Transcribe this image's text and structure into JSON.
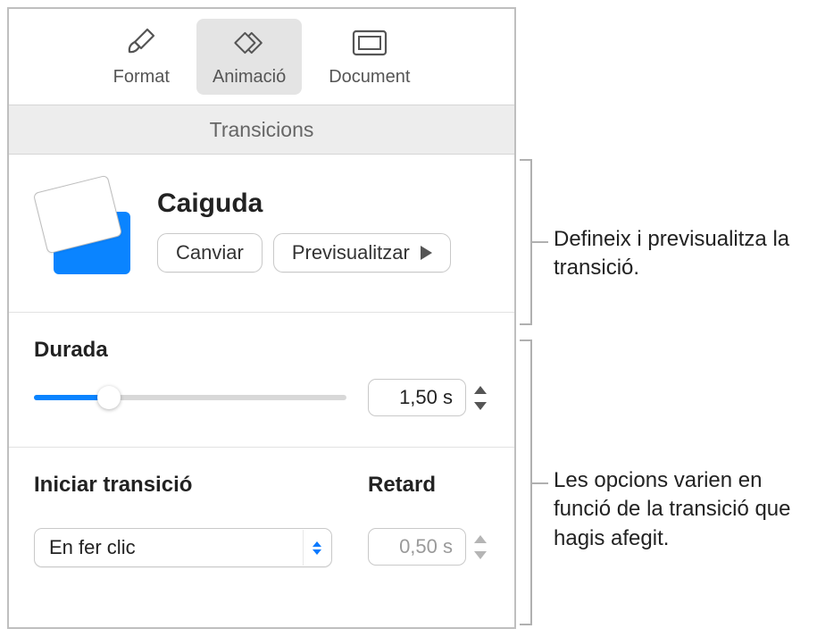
{
  "toolbar": {
    "format_label": "Format",
    "animation_label": "Animació",
    "document_label": "Document",
    "selected": "animation"
  },
  "section": {
    "title": "Transicions"
  },
  "transition": {
    "name": "Caiguda",
    "change_label": "Canviar",
    "preview_label": "Previsualitzar"
  },
  "duration": {
    "label": "Durada",
    "value_display": "1,50 s",
    "value_seconds": 1.5,
    "min": 0.5,
    "max": 5.0,
    "slider_percent": 24
  },
  "start": {
    "label": "Iniciar transició",
    "selected_option": "En fer clic"
  },
  "delay": {
    "label": "Retard",
    "value_display": "0,50 s",
    "enabled": false
  },
  "callouts": {
    "one": "Defineix i previsualitza la transició.",
    "two": "Les opcions varien en funció de la transició que hagis afegit."
  }
}
